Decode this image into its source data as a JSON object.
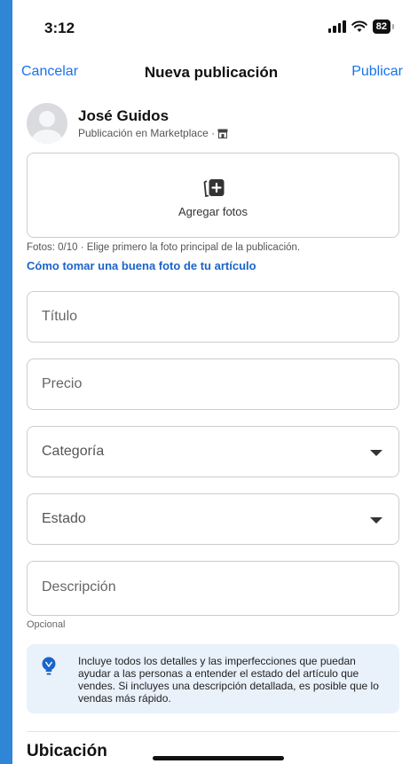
{
  "status": {
    "time": "3:12",
    "battery": "82"
  },
  "nav": {
    "cancel": "Cancelar",
    "title": "Nueva publicación",
    "publish": "Publicar"
  },
  "user": {
    "name": "José Guidos",
    "subtitle": "Publicación en Marketplace ·"
  },
  "photos": {
    "add_label": "Agregar fotos",
    "hint": "Fotos: 0/10 · Elige primero la foto principal de la publicación.",
    "tips_link": "Cómo tomar una buena foto de tu artículo"
  },
  "fields": {
    "title_placeholder": "Título",
    "price_placeholder": "Precio",
    "category_label": "Categoría",
    "condition_label": "Estado",
    "description_placeholder": "Descripción",
    "optional": "Opcional"
  },
  "tip": "Incluye todos los detalles y las imperfecciones que puedan ayudar a las personas a entender el estado del artículo que vendes. Si incluyes una descripción detallada, es posible que lo vendas más rápido.",
  "location": {
    "heading": "Ubicación"
  },
  "colors": {
    "accent": "#1a73e8",
    "link": "#1a64c8",
    "tip_bg": "#e9f1fb",
    "frame": "#2f86d6"
  }
}
